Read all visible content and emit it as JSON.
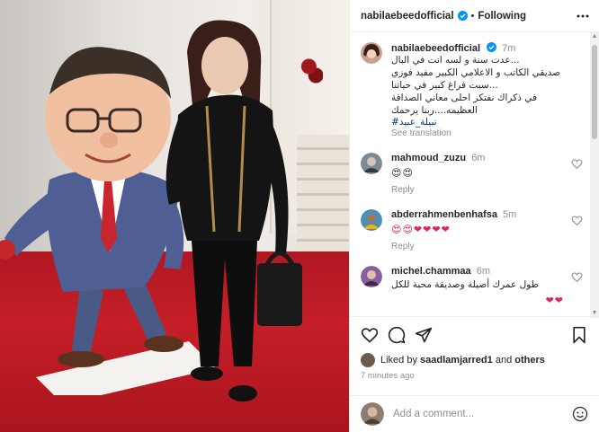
{
  "post": {
    "username": "nabilaebeedofficial",
    "follow_status": "Following",
    "caption": {
      "time": "7m",
      "lines": [
        "...عدت سنة و لسه انت في البال",
        "صديقي الكاتب و الاعلامي الكبير مفيد فوزي",
        "...سبت فراغ كبير في حياتنا",
        "في ذكراك نفتكر احلى معاني الصداقة",
        "العظيمه....ربنا يرحمك"
      ],
      "hashtag": "#نبيلة_عبيد",
      "see_translation": "See translation"
    },
    "comments": [
      {
        "username": "mahmoud_zuzu",
        "time": "6m",
        "text": "",
        "emojis": "😍😍",
        "reply": "Reply"
      },
      {
        "username": "abderrahmenbenhafsa",
        "time": "5m",
        "text": "",
        "emojis": "😍😍❤❤❤❤",
        "reply": "Reply"
      },
      {
        "username": "michel.chammaa",
        "time": "6m",
        "text": "طول عمرك أصيلة وصديقة محبة للكل",
        "emojis": "❤❤",
        "reply": ""
      }
    ],
    "liked_by": {
      "prefix": "Liked by",
      "user": "saadlamjarred1",
      "conj": "and",
      "others": "others"
    },
    "posted_ago": "7 minutes ago",
    "add_comment_placeholder": "Add a comment..."
  },
  "colors": {
    "link": "#00376b",
    "muted": "#8e8e8e",
    "verified": "#0095f6",
    "carpet": "#c51f28"
  },
  "icons": [
    "verified-icon",
    "more-icon",
    "heart-icon",
    "comment-icon",
    "share-icon",
    "save-icon",
    "emoji-icon"
  ]
}
